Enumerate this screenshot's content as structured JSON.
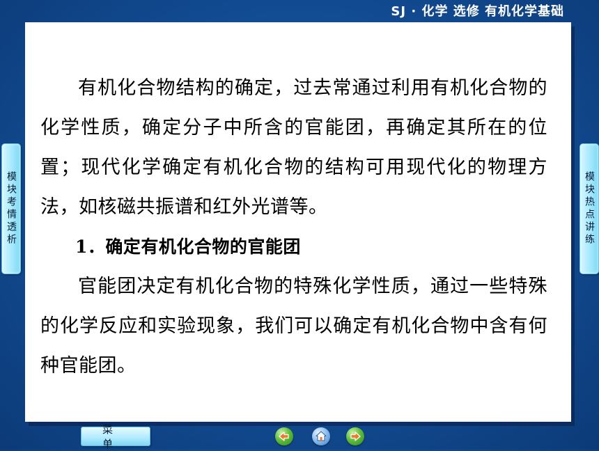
{
  "header": {
    "title": "SJ · 化学  选修  有机化学基础"
  },
  "content": {
    "paragraph1": "有机化合物结构的确定，过去常通过利用有机化合物的化学性质，确定分子中所含的官能团，再确定其所在的位置；现代化学确定有机化合物的结构可用现代化的物理方法，如核磁共振谱和红外光谱等。",
    "section1": {
      "number": "1．",
      "title": "确定有机化合物的官能团"
    },
    "paragraph2": "官能团决定有机化合物的特殊化学性质，通过一些特殊的化学反应和实验现象，我们可以确定有机化合物中含有何种官能团。"
  },
  "side_tabs": {
    "left": "模块考情透析",
    "right": "模块热点讲练"
  },
  "footer": {
    "menu_label": "菜单",
    "icons": {
      "prev": "arrow-left-icon",
      "home": "home-icon",
      "next": "arrow-right-icon"
    }
  },
  "colors": {
    "background": "#134f98",
    "panel": "#ffffff",
    "tab": "#a9eaff",
    "nav_green": "#5fbd3a",
    "nav_blue": "#3a7fc7"
  }
}
